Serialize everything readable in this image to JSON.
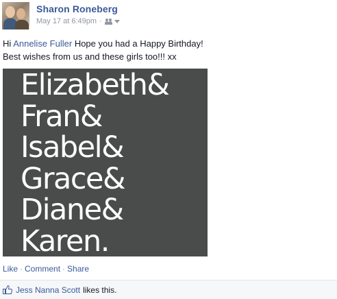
{
  "post": {
    "author": "Sharon Roneberg",
    "timestamp": "May 17 at 6:49pm",
    "separator": "·",
    "audience_icon": "friends-icon",
    "message": {
      "greeting": "Hi",
      "mention": "Annelise Fuller",
      "line1_rest": "Hope you had a Happy Birthday!",
      "line2": "Best wishes from us and these girls too!!! xx"
    },
    "photo_text": [
      "Elizabeth&",
      "Fran&",
      "Isabel&",
      "Grace&",
      "Diane&",
      "Karen."
    ],
    "actions": {
      "like": "Like",
      "comment": "Comment",
      "share": "Share",
      "dot": "·"
    },
    "likes": {
      "icon": "thumbs-up-icon",
      "name": "Jess Nanna Scott",
      "suffix": "likes this."
    }
  },
  "colors": {
    "link": "#3b5998",
    "meta": "#9197a3",
    "photo_bg": "#4a4c4c"
  }
}
